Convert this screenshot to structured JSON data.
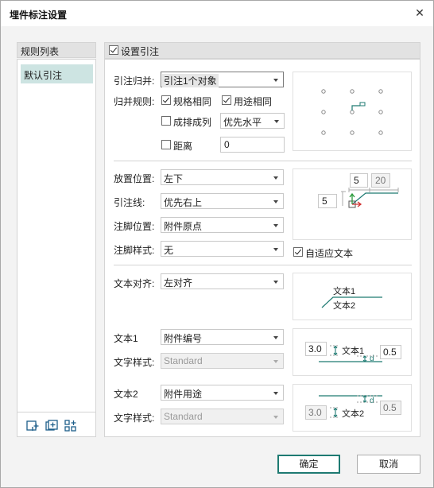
{
  "window": {
    "title": "埋件标注设置",
    "close_icon": "close-icon"
  },
  "left_panel": {
    "header": "规则列表",
    "rules": [
      {
        "label": "默认引注",
        "selected": true
      }
    ],
    "footer_icons": [
      "add-rule-icon",
      "copy-rule-icon",
      "manage-rules-icon"
    ]
  },
  "right_panel": {
    "enable": {
      "label": "设置引注",
      "checked": true
    },
    "group": {
      "label": "引注归并:",
      "value": "引注1个对象",
      "rules_label": "归并规则:",
      "same_spec": {
        "label": "规格相同",
        "checked": true
      },
      "same_use": {
        "label": "用途相同",
        "checked": true
      },
      "in_rows": {
        "label": "成排成列",
        "checked": false
      },
      "row_priority": "优先水平",
      "distance": {
        "label": "距离",
        "checked": false,
        "value": "0"
      }
    },
    "placement": {
      "label": "放置位置:",
      "value": "左下"
    },
    "leader": {
      "label": "引注线:",
      "value": "优先右上"
    },
    "foot_position": {
      "label": "注脚位置:",
      "value": "附件原点"
    },
    "foot_style": {
      "label": "注脚样式:",
      "value": "无"
    },
    "auto_fit": {
      "label": "自适应文本",
      "checked": true
    },
    "align": {
      "label": "文本对齐:",
      "value": "左对齐"
    },
    "text1": {
      "label": "文本1",
      "value": "附件编号",
      "style_label": "文字样式:",
      "style": "Standard"
    },
    "text2": {
      "label": "文本2",
      "value": "附件用途",
      "style_label": "文字样式:",
      "style": "Standard"
    },
    "previews": {
      "placement": {
        "offset_top": "5",
        "offset_top2": "20",
        "offset_left": "5"
      },
      "align": {
        "line1": "文本1",
        "line2": "文本2"
      },
      "text1": {
        "height": "3.0",
        "text": "文本1",
        "gap": "0.5",
        "d": "d"
      },
      "text2": {
        "height": "3.0",
        "text": "文本2",
        "gap": "0.5",
        "d": "d"
      }
    }
  },
  "buttons": {
    "ok": "确定",
    "cancel": "取消"
  },
  "colors": {
    "accent": "#1e7a72",
    "selection": "#cde4e2",
    "green": "#2a9a3a",
    "red": "#d03030"
  }
}
